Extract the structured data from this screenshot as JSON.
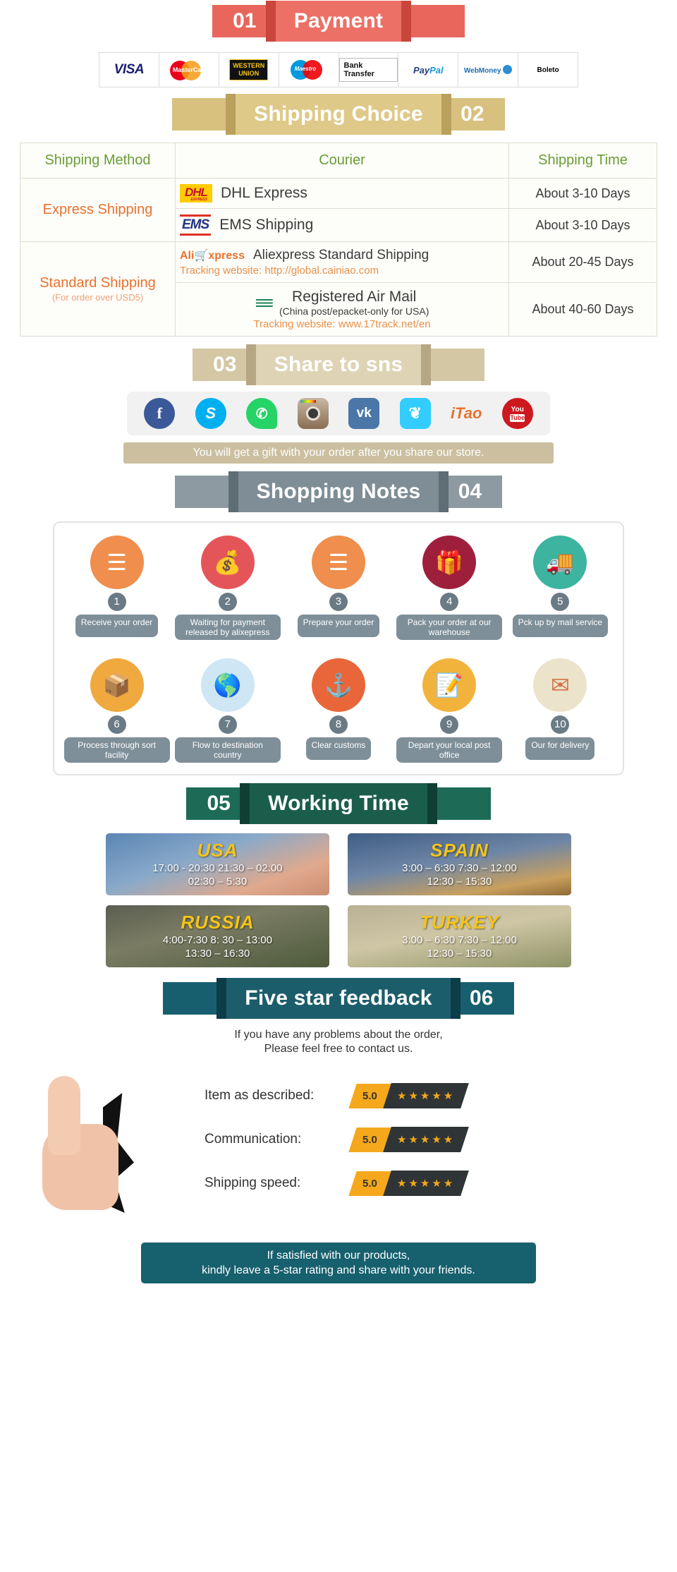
{
  "sections": {
    "payment": {
      "number": "01",
      "title": "Payment"
    },
    "shipping": {
      "number": "02",
      "title": "Shipping Choice"
    },
    "share": {
      "number": "03",
      "title": "Share to sns"
    },
    "notes": {
      "number": "04",
      "title": "Shopping Notes"
    },
    "working": {
      "number": "05",
      "title": "Working Time"
    },
    "feedback": {
      "number": "06",
      "title": "Five star feedback"
    }
  },
  "payment_methods": [
    {
      "name": "visa-logo",
      "label": "VISA"
    },
    {
      "name": "mastercard-logo",
      "label": "MasterCard"
    },
    {
      "name": "western-union-logo",
      "label": "WESTERN",
      "label2": "UNION"
    },
    {
      "name": "maestro-logo",
      "label": "Maestro"
    },
    {
      "name": "bank-transfer-logo",
      "label": "Bank Transfer"
    },
    {
      "name": "paypal-logo",
      "label": "Pay",
      "label2": "Pal"
    },
    {
      "name": "webmoney-logo",
      "label": "WebMoney"
    },
    {
      "name": "boleto-logo",
      "label": "Boleto"
    }
  ],
  "shipping_table": {
    "headers": [
      "Shipping Method",
      "Courier",
      "Shipping Time"
    ],
    "groups": [
      {
        "method": "Express Shipping",
        "method_note": "",
        "rows": [
          {
            "logo": "DHL",
            "courier": "DHL Express",
            "sub": "",
            "track": "",
            "time": "About 3-10 Days"
          },
          {
            "logo": "EMS",
            "courier": "EMS Shipping",
            "sub": "",
            "track": "",
            "time": "About 3-10 Days"
          }
        ]
      },
      {
        "method": "Standard Shipping",
        "method_note": "(For order over USD5)",
        "rows": [
          {
            "logo": "AliExpress",
            "courier": "Aliexpress Standard Shipping",
            "sub": "",
            "track": "Tracking website: http://global.cainiao.com",
            "time": "About 20-45 Days"
          },
          {
            "logo": "ChinaPost",
            "courier": "Registered Air Mail",
            "sub": "(China post/epacket-only for USA)",
            "track": "Tracking website: www.17track.net/en",
            "time": "About 40-60 Days"
          }
        ]
      }
    ]
  },
  "social": {
    "icons": [
      {
        "name": "facebook-icon",
        "glyph": "f"
      },
      {
        "name": "skype-icon",
        "glyph": "S"
      },
      {
        "name": "whatsapp-icon",
        "glyph": "✆"
      },
      {
        "name": "instagram-icon",
        "glyph": ""
      },
      {
        "name": "vk-icon",
        "glyph": "vk"
      },
      {
        "name": "twitter-icon",
        "glyph": "❦"
      },
      {
        "name": "itao-icon",
        "glyph": "iTao"
      },
      {
        "name": "youtube-icon",
        "glyph": "You",
        "glyph2": "Tube"
      }
    ],
    "note": "You will get a gift with your order after you share our store."
  },
  "shopping_notes": [
    {
      "num": "1",
      "icon": "document-icon",
      "color": "#ef8e4d",
      "glyph": "☷",
      "label": "Receive\nyour order"
    },
    {
      "num": "2",
      "icon": "money-bag-icon",
      "color": "#e4555a",
      "glyph": "$",
      "label": "Waiting for payment\nreleased by alixepress"
    },
    {
      "num": "3",
      "icon": "document-icon",
      "color": "#ef8e4d",
      "glyph": "☷",
      "label": "Prepare\nyour order"
    },
    {
      "num": "4",
      "icon": "gift-box-icon",
      "color": "#9e1f3c",
      "glyph": "❁",
      "label": "Pack your order\nat our warehouse"
    },
    {
      "num": "5",
      "icon": "mail-truck-icon",
      "color": "#3cb4a0",
      "glyph": "⛟",
      "label": "Pck up by\nmail service"
    },
    {
      "num": "6",
      "icon": "sort-facility-icon",
      "color": "#f0a93e",
      "glyph": "⚙",
      "label": "Process through\nsort facility"
    },
    {
      "num": "7",
      "icon": "globe-icon",
      "color": "#cfe6f5",
      "glyph": "ἱ0",
      "label": "Flow to destination\ncountry"
    },
    {
      "num": "8",
      "icon": "anchor-icon",
      "color": "#e8663a",
      "glyph": "⚓",
      "label": "Clear\ncustoms"
    },
    {
      "num": "9",
      "icon": "clipboard-icon",
      "color": "#f2b33d",
      "glyph": "✎",
      "label": "Depart your\nlocal post office"
    },
    {
      "num": "10",
      "icon": "package-icon",
      "color": "#e8e0c8",
      "glyph": "✉",
      "label": "Our for\ndelivery"
    }
  ],
  "working_time": [
    {
      "country": "USA",
      "times": "17:00 - 20:30  21:30 – 02:00\n02:30 – 5:30"
    },
    {
      "country": "SPAIN",
      "times": "3:00 – 6:30   7:30 – 12:00\n12:30 – 15:30"
    },
    {
      "country": "RUSSIA",
      "times": "4:00-7:30  8: 30 – 13:00\n13:30 – 16:30"
    },
    {
      "country": "TURKEY",
      "times": "3:00 – 6:30   7:30 – 12:00\n12:30 – 15:30"
    }
  ],
  "feedback": {
    "intro": "If you have any problems about the order,\nPlease feel free to contact us.",
    "ratings": [
      {
        "label": "Item as described:",
        "score": "5.0",
        "stars": "★★★★★"
      },
      {
        "label": "Communication:",
        "score": "5.0",
        "stars": "★★★★★"
      },
      {
        "label": "Shipping speed:",
        "score": "5.0",
        "stars": "★★★★★"
      }
    ],
    "footer": "If satisfied with our products,\nkindly leave a 5-star rating and share with your friends."
  }
}
